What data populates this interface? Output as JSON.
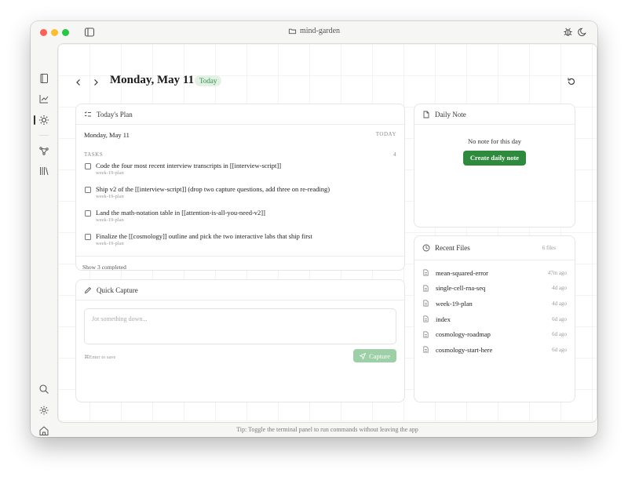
{
  "window": {
    "title": "mind-garden"
  },
  "page": {
    "title": "Monday, May 11",
    "badge": "Today"
  },
  "plan": {
    "header": "Today's Plan",
    "date": "Monday, May 11",
    "date_tag": "TODAY",
    "tasks_label": "TASKS",
    "tasks_count": "4",
    "tasks": [
      {
        "text": "Code the four most recent interview transcripts in [[interview-script]]",
        "source": "week-19-plan"
      },
      {
        "text": "Ship v2 of the [[interview-script]] (drop two capture questions, add three on re-reading)",
        "source": "week-19-plan"
      },
      {
        "text": "Land the math-notation table in [[attention-is-all-you-need-v2]]",
        "source": "week-19-plan"
      },
      {
        "text": "Finalize the [[cosmology]] outline and pick the two interactive labs that ship first",
        "source": "week-19-plan"
      }
    ],
    "show_completed": "Show 3 completed"
  },
  "capture": {
    "header": "Quick Capture",
    "placeholder": "Jot something down...",
    "hint": "⌘Enter to save",
    "button": "Capture"
  },
  "daily": {
    "header": "Daily Note",
    "empty": "No note for this day",
    "button": "Create daily note"
  },
  "recent": {
    "header": "Recent Files",
    "count": "6 files",
    "files": [
      {
        "name": "mean-squared-error",
        "time": "47m ago"
      },
      {
        "name": "single-cell-rna-seq",
        "time": "4d ago"
      },
      {
        "name": "week-19-plan",
        "time": "4d ago"
      },
      {
        "name": "index",
        "time": "6d ago"
      },
      {
        "name": "cosmology-roadmap",
        "time": "6d ago"
      },
      {
        "name": "cosmology-start-here",
        "time": "6d ago"
      }
    ]
  },
  "tip": "Tip: Toggle the terminal panel to run commands without leaving the app",
  "colors": {
    "accent": "#2e8a3c",
    "badge_bg": "#e3f1e5",
    "capture_disabled": "#9dd0a7"
  }
}
